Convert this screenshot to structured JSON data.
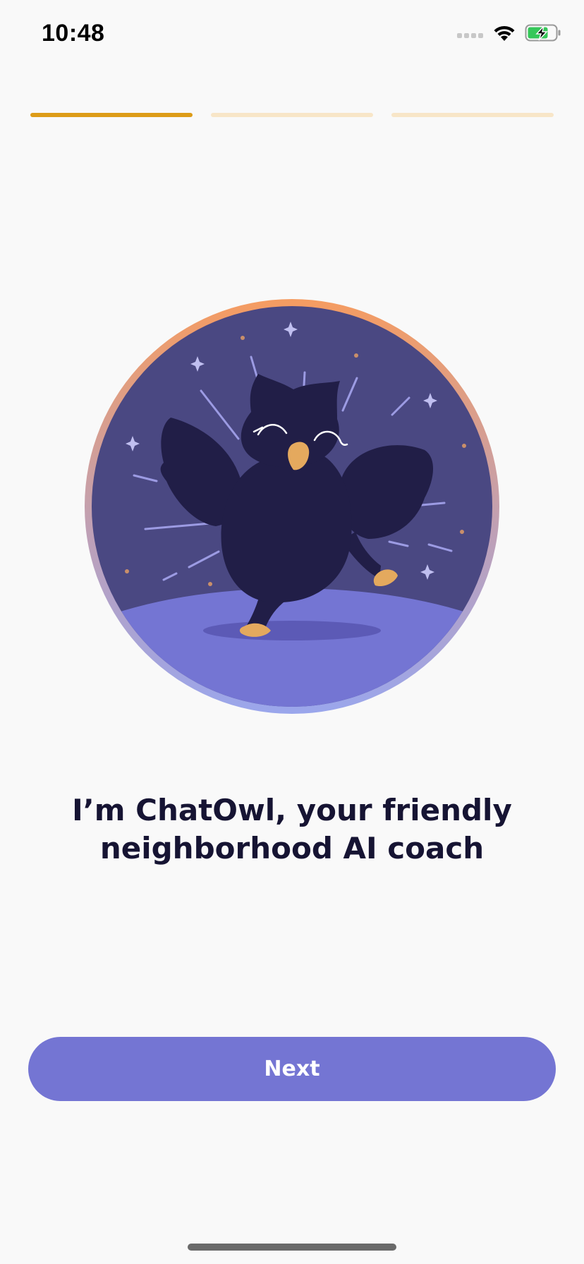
{
  "status_bar": {
    "time": "10:48",
    "icons": [
      "cellular-dots-icon",
      "wifi-icon",
      "battery-charging-icon"
    ]
  },
  "onboarding": {
    "progress": {
      "total_steps": 3,
      "current_step": 1
    },
    "illustration": "dancing-owl-illustration",
    "headline": "I’m ChatOwl, your friendly neighborhood AI coach",
    "next_label": "Next"
  },
  "colors": {
    "background": "#f9f9f9",
    "progress_active": "#dd9c18",
    "progress_inactive": "#f8e6c8",
    "button": "#7475d3",
    "headline": "#161433",
    "owl_body": "#211e47",
    "night_sky": "#4a4882",
    "ground": "#7475d3",
    "beak_feet": "#e4a95e"
  }
}
